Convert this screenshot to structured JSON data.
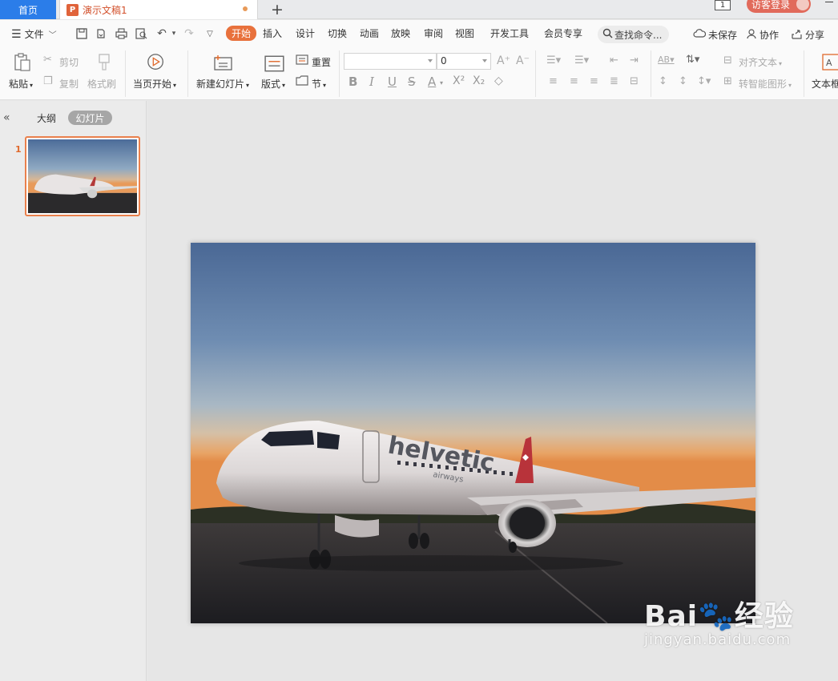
{
  "tabs": {
    "home": "首页",
    "document_title": "演示文稿1",
    "add": "+",
    "window_count": "1",
    "login": "访客登录"
  },
  "menu": {
    "file": "文件",
    "ribbon_tabs": [
      "开始",
      "插入",
      "设计",
      "切换",
      "动画",
      "放映",
      "审阅",
      "视图",
      "开发工具",
      "会员专享"
    ],
    "active_tab": "开始",
    "command_search": "查找命令...",
    "unsaved": "未保存",
    "collaborate": "协作",
    "share": "分享"
  },
  "ribbon": {
    "paste": "粘贴",
    "cut": "剪切",
    "copy": "复制",
    "format_painter": "格式刷",
    "play_from_current": "当页开始",
    "new_slide": "新建幻灯片",
    "layout": "版式",
    "reset": "重置",
    "section": "节",
    "font_name": "",
    "font_size": "0",
    "align_text": "对齐文本",
    "smart_graphic": "转智能图形",
    "text_box": "文本框"
  },
  "panel": {
    "outline_tab": "大纲",
    "slides_tab": "幻灯片",
    "slide_number": "1"
  },
  "slide": {
    "image_description": "Airplane photo",
    "livery_text": "helvetic",
    "livery_subtext": "airways"
  },
  "watermark": {
    "brand": "Bai",
    "brand_cn": "经验",
    "url": "jingyan.baidu.com"
  },
  "colors": {
    "accent": "#e8713c",
    "home_tab": "#2b7de9",
    "login": "#e16a5b"
  }
}
